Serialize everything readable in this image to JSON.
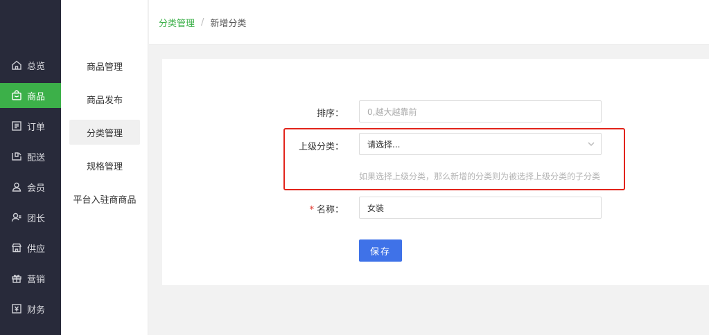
{
  "leftnav": {
    "items": [
      {
        "label": "总览",
        "icon": "home-icon"
      },
      {
        "label": "商品",
        "icon": "shopping-bag-icon",
        "active": true
      },
      {
        "label": "订单",
        "icon": "order-list-icon"
      },
      {
        "label": "配送",
        "icon": "delivery-icon"
      },
      {
        "label": "会员",
        "icon": "member-icon"
      },
      {
        "label": "团长",
        "icon": "leader-icon"
      },
      {
        "label": "供应",
        "icon": "store-icon"
      },
      {
        "label": "营销",
        "icon": "gift-icon"
      },
      {
        "label": "财务",
        "icon": "finance-icon"
      }
    ],
    "active_color": "#3cb049"
  },
  "subnav": {
    "items": [
      {
        "label": "商品管理"
      },
      {
        "label": "商品发布"
      },
      {
        "label": "分类管理",
        "active": true
      },
      {
        "label": "规格管理"
      },
      {
        "label": "平台入驻商商品"
      }
    ]
  },
  "breadcrumb": {
    "parent": "分类管理",
    "separator": "/",
    "current": "新增分类"
  },
  "form": {
    "sort": {
      "label": "排序：",
      "placeholder": "0,越大越靠前",
      "value": ""
    },
    "parent_category": {
      "label": "上级分类：",
      "value": "请选择...",
      "hint": "如果选择上级分类，那么新增的分类则为被选择上级分类的子分类"
    },
    "name": {
      "required_mark": "*",
      "label": "名称：",
      "value": "女装"
    },
    "save_label": "保存"
  },
  "colors": {
    "primary_button": "#3f72e8",
    "highlight_box": "#e2231a",
    "required": "#e0352b"
  }
}
